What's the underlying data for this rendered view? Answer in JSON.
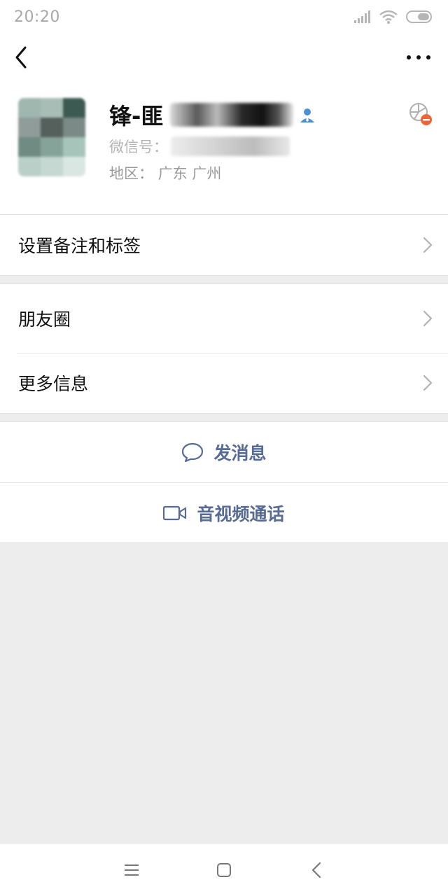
{
  "status_bar": {
    "time": "20:20"
  },
  "profile": {
    "name": "锋-匪",
    "wechat_id_label": "微信号：",
    "region_label": "地区：",
    "region_value": "广东  广州"
  },
  "menu": {
    "remark_label": "设置备注和标签",
    "moments_label": "朋友圈",
    "more_info_label": "更多信息"
  },
  "actions": {
    "message_label": "发消息",
    "video_call_label": "音视频通话"
  },
  "colors": {
    "link_blue": "#576b95",
    "background": "#ededed"
  },
  "icons": {
    "back": "chevron-left-icon",
    "more": "more-dots-icon",
    "user_badge": "user-icon",
    "message": "chat-bubble-icon",
    "video": "video-camera-icon"
  }
}
